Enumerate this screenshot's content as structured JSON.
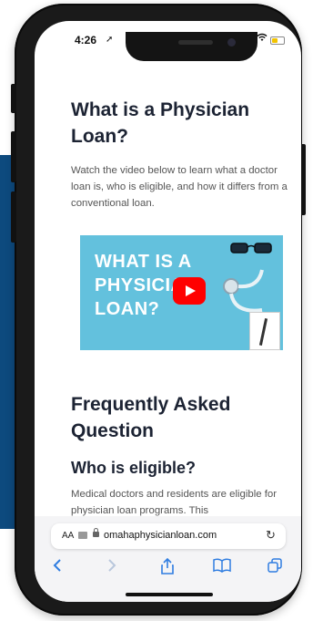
{
  "status_bar": {
    "time": "4:26"
  },
  "article": {
    "heading": "What is a Physician Loan?",
    "intro": "Watch the video below to learn what a doctor loan is, who is eligible, and how it differs from a conventional loan.",
    "video": {
      "line1": "WHAT IS A",
      "line2": "PHYSICIAN",
      "line3": "LOAN?"
    },
    "faq_heading": "Frequently Asked Question",
    "faq_subheading": "Who is eligible?",
    "faq_text": "Medical doctors and residents are eligible for physician loan programs. This"
  },
  "browser": {
    "text_size_label": "AA",
    "url": "omahaphysicianloan.com"
  },
  "icons": {
    "back": "chevron-left-icon",
    "forward": "chevron-right-icon",
    "share": "share-icon",
    "bookmarks": "book-icon",
    "tabs": "tabs-icon"
  },
  "colors": {
    "link_blue": "#2f7de1",
    "video_bg": "#63c1dd",
    "play_red": "#ff0000",
    "side_panel": "#0d4a7e"
  }
}
